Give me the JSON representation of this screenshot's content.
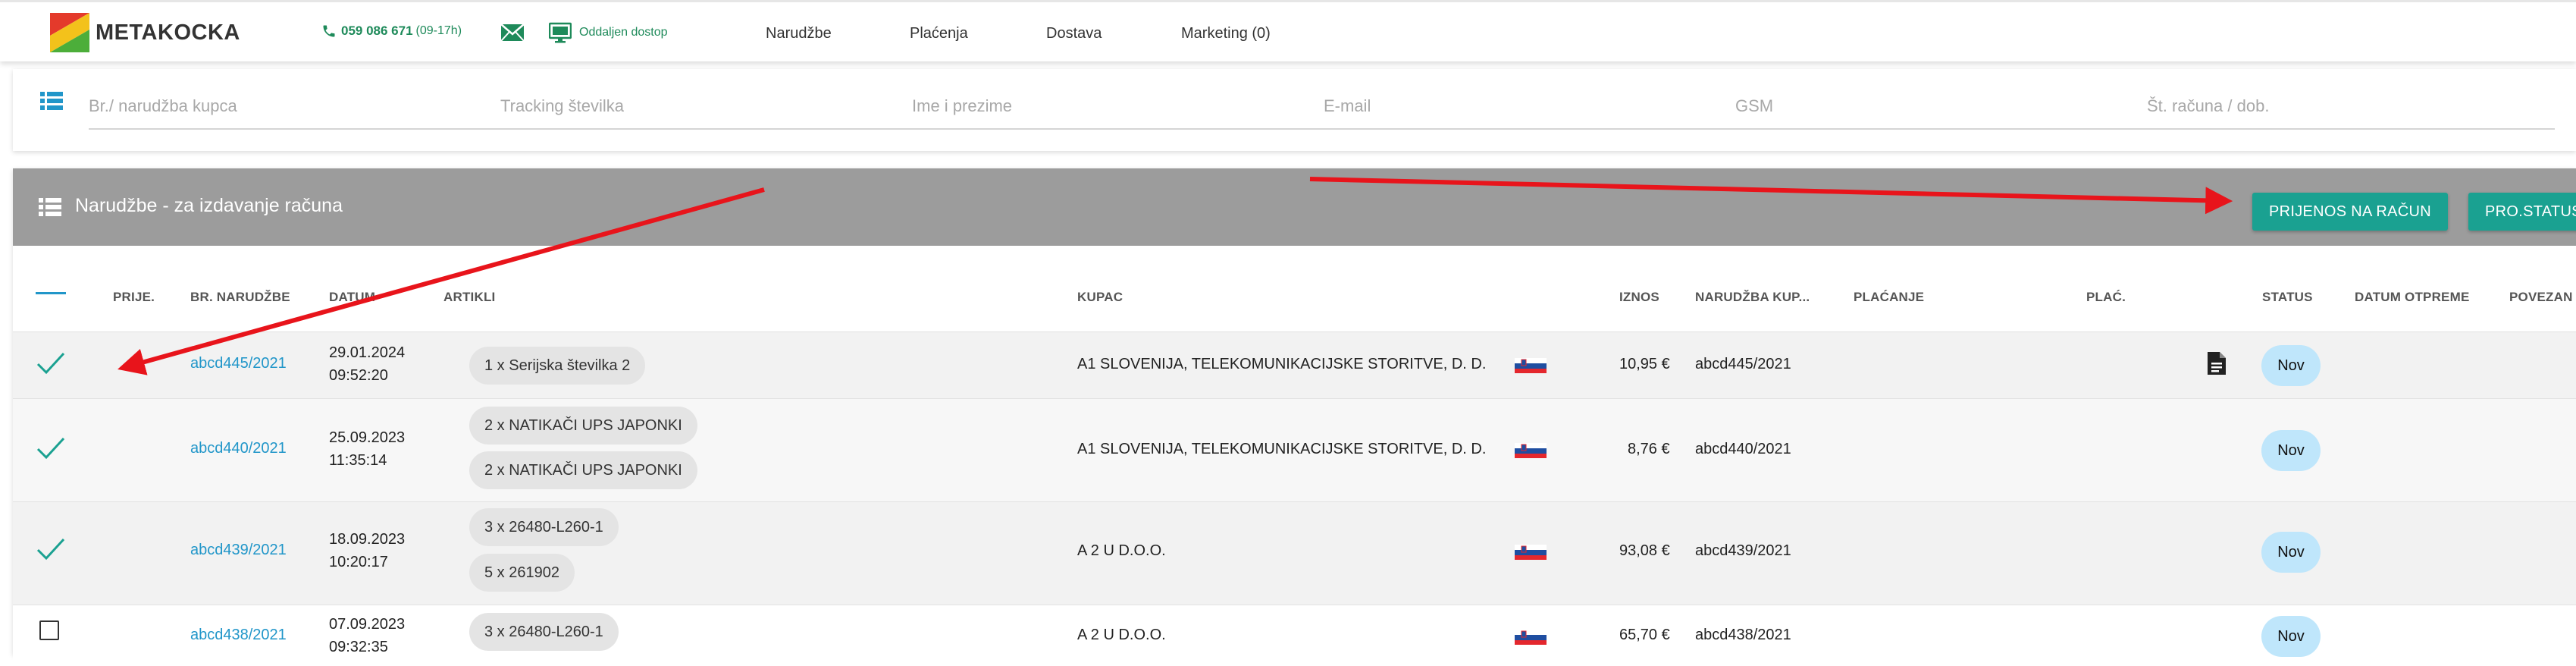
{
  "brand": {
    "name": "METAKOCKA",
    "colors": {
      "red": "#e43a2b",
      "yellow": "#f3c21b",
      "green": "#4cae3a"
    }
  },
  "header": {
    "phone_number": "059 086 671",
    "phone_hours": "(09-17h)",
    "remote_label": "Oddaljen dostop",
    "nav": [
      "Narudžbe",
      "Plaćenja",
      "Dostava",
      "Marketing (0)"
    ]
  },
  "search": {
    "placeholders": [
      "Br./ narudžba kupca",
      "Tracking številka",
      "Ime i prezime",
      "E-mail",
      "GSM",
      "Št. računa / dob."
    ]
  },
  "panel": {
    "title": "Narudžbe - za izdavanje računa",
    "buttons": [
      "PRIJENOS NA RAČUN",
      "PRO.STATUS"
    ]
  },
  "table": {
    "columns": [
      "PRIJE.",
      "BR. NARUDŽBE",
      "DATUM",
      "ARTIKLI",
      "KUPAC",
      "IZNOS",
      "NARUDŽBA KUP...",
      "PLAĆANJE",
      "PLAĆ.",
      "STATUS",
      "DATUM OTPREME",
      "POVEZAN"
    ],
    "rows": [
      {
        "checked": true,
        "order": "abcd445/2021",
        "date": "29.01.2024",
        "time": "09:52:20",
        "items": [
          "1 x Serijska številka 2"
        ],
        "customer": "A1 SLOVENIJA, TELEKOMUNIKACIJSKE STORITVE, D. D.",
        "amount": "10,95 €",
        "customer_order": "abcd445/2021",
        "has_document": true,
        "status": "Nov"
      },
      {
        "checked": true,
        "order": "abcd440/2021",
        "date": "25.09.2023",
        "time": "11:35:14",
        "items": [
          "2 x NATIKAČI UPS JAPONKI",
          "2 x NATIKAČI UPS JAPONKI"
        ],
        "customer": "A1 SLOVENIJA, TELEKOMUNIKACIJSKE STORITVE, D. D.",
        "amount": "8,76 €",
        "customer_order": "abcd440/2021",
        "has_document": false,
        "status": "Nov"
      },
      {
        "checked": true,
        "order": "abcd439/2021",
        "date": "18.09.2023",
        "time": "10:20:17",
        "items": [
          "3 x 26480-L260-1",
          "5 x 261902"
        ],
        "customer": "A 2 U D.O.O.",
        "amount": "93,08 €",
        "customer_order": "abcd439/2021",
        "has_document": false,
        "status": "Nov"
      },
      {
        "checked": false,
        "order": "abcd438/2021",
        "date": "07.09.2023",
        "time": "09:32:35",
        "items": [
          "3 x 26480-L260-1"
        ],
        "customer": "A 2 U D.O.O.",
        "amount": "65,70 €",
        "customer_order": "abcd438/2021",
        "has_document": false,
        "status": "Nov"
      }
    ]
  },
  "annotation_color": "#e8141b"
}
